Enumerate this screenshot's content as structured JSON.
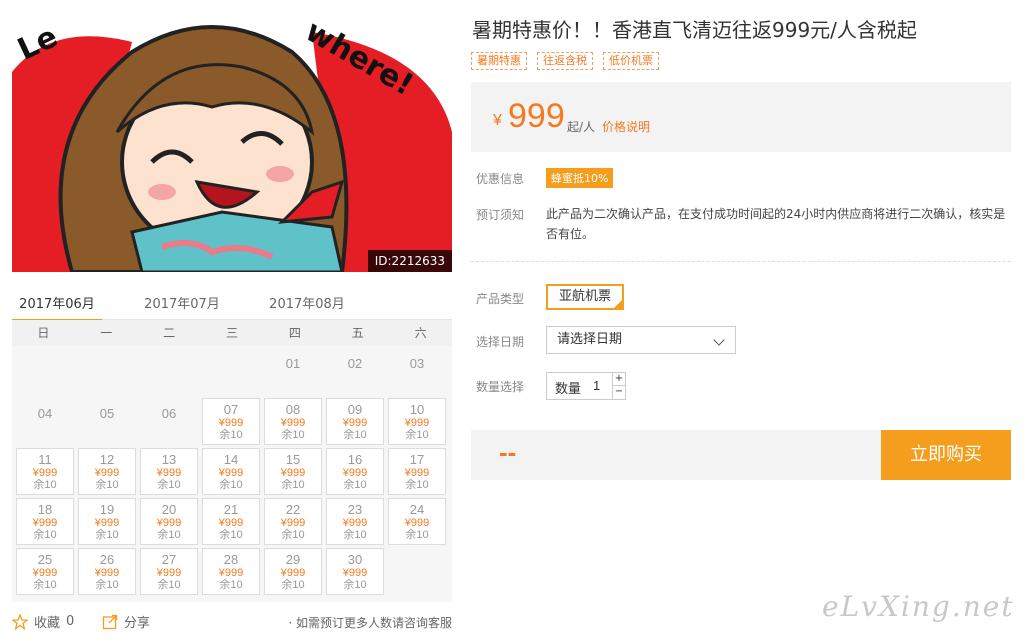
{
  "hero": {
    "text": "Let's go Somewhere!",
    "id_label": "ID:2212633",
    "colors": {
      "bg_red": "#e51e25",
      "hair": "#8b5a2b"
    }
  },
  "calendar": {
    "months": [
      {
        "label": "2017年06月",
        "active": true
      },
      {
        "label": "2017年07月",
        "active": false
      },
      {
        "label": "2017年08月",
        "active": false
      }
    ],
    "weekdays": [
      "日",
      "一",
      "二",
      "三",
      "四",
      "五",
      "六"
    ],
    "empty_days": [
      {
        "d": "01",
        "row": 0,
        "col": 4
      },
      {
        "d": "02",
        "row": 0,
        "col": 5
      },
      {
        "d": "03",
        "row": 0,
        "col": 6
      },
      {
        "d": "04",
        "row": 1,
        "col": 0
      },
      {
        "d": "05",
        "row": 1,
        "col": 1
      },
      {
        "d": "06",
        "row": 1,
        "col": 2
      }
    ],
    "days": [
      {
        "d": "07",
        "row": 1,
        "col": 3,
        "price": "¥999",
        "stock": "余10"
      },
      {
        "d": "08",
        "row": 1,
        "col": 4,
        "price": "¥999",
        "stock": "余10"
      },
      {
        "d": "09",
        "row": 1,
        "col": 5,
        "price": "¥999",
        "stock": "余10"
      },
      {
        "d": "10",
        "row": 1,
        "col": 6,
        "price": "¥999",
        "stock": "余10"
      },
      {
        "d": "11",
        "row": 2,
        "col": 0,
        "price": "¥999",
        "stock": "余10"
      },
      {
        "d": "12",
        "row": 2,
        "col": 1,
        "price": "¥999",
        "stock": "余10"
      },
      {
        "d": "13",
        "row": 2,
        "col": 2,
        "price": "¥999",
        "stock": "余10"
      },
      {
        "d": "14",
        "row": 2,
        "col": 3,
        "price": "¥999",
        "stock": "余10"
      },
      {
        "d": "15",
        "row": 2,
        "col": 4,
        "price": "¥999",
        "stock": "余10"
      },
      {
        "d": "16",
        "row": 2,
        "col": 5,
        "price": "¥999",
        "stock": "余10"
      },
      {
        "d": "17",
        "row": 2,
        "col": 6,
        "price": "¥999",
        "stock": "余10"
      },
      {
        "d": "18",
        "row": 3,
        "col": 0,
        "price": "¥999",
        "stock": "余10"
      },
      {
        "d": "19",
        "row": 3,
        "col": 1,
        "price": "¥999",
        "stock": "余10"
      },
      {
        "d": "20",
        "row": 3,
        "col": 2,
        "price": "¥999",
        "stock": "余10"
      },
      {
        "d": "21",
        "row": 3,
        "col": 3,
        "price": "¥999",
        "stock": "余10"
      },
      {
        "d": "22",
        "row": 3,
        "col": 4,
        "price": "¥999",
        "stock": "余10"
      },
      {
        "d": "23",
        "row": 3,
        "col": 5,
        "price": "¥999",
        "stock": "余10"
      },
      {
        "d": "24",
        "row": 3,
        "col": 6,
        "price": "¥999",
        "stock": "余10"
      },
      {
        "d": "25",
        "row": 4,
        "col": 0,
        "price": "¥999",
        "stock": "余10"
      },
      {
        "d": "26",
        "row": 4,
        "col": 1,
        "price": "¥999",
        "stock": "余10"
      },
      {
        "d": "27",
        "row": 4,
        "col": 2,
        "price": "¥999",
        "stock": "余10"
      },
      {
        "d": "28",
        "row": 4,
        "col": 3,
        "price": "¥999",
        "stock": "余10"
      },
      {
        "d": "29",
        "row": 4,
        "col": 4,
        "price": "¥999",
        "stock": "余10"
      },
      {
        "d": "30",
        "row": 4,
        "col": 5,
        "price": "¥999",
        "stock": "余10"
      }
    ]
  },
  "footer": {
    "favorite_label": "收藏",
    "favorite_count": "0",
    "share_label": "分享",
    "note": "· 如需预订更多人数请咨询客服"
  },
  "product": {
    "title": "暑期特惠价！！香港直飞清迈往返999元/人含税起",
    "tags": [
      "暑期特惠",
      "往返含税",
      "低价机票"
    ],
    "currency": "¥",
    "price": "999",
    "price_unit": "起/人",
    "price_link": "价格说明",
    "labels": {
      "discount": "优惠信息",
      "notice": "预订须知",
      "type": "产品类型",
      "date": "选择日期",
      "qty": "数量选择"
    },
    "discount_badge": "蜂蜜抵10%",
    "notice_text": "此产品为二次确认产品，在支付成功时间起的24小时内供应商将进行二次确认，核实是否有位。",
    "type_option": "亚航机票",
    "date_placeholder": "请选择日期",
    "qty_label": "数量",
    "qty_value": "1",
    "qty_plus": "+",
    "qty_minus": "−",
    "total": "--",
    "buy_label": "立即购买",
    "accent_color": "#f59d1d"
  },
  "watermark": "eLvXing.net"
}
